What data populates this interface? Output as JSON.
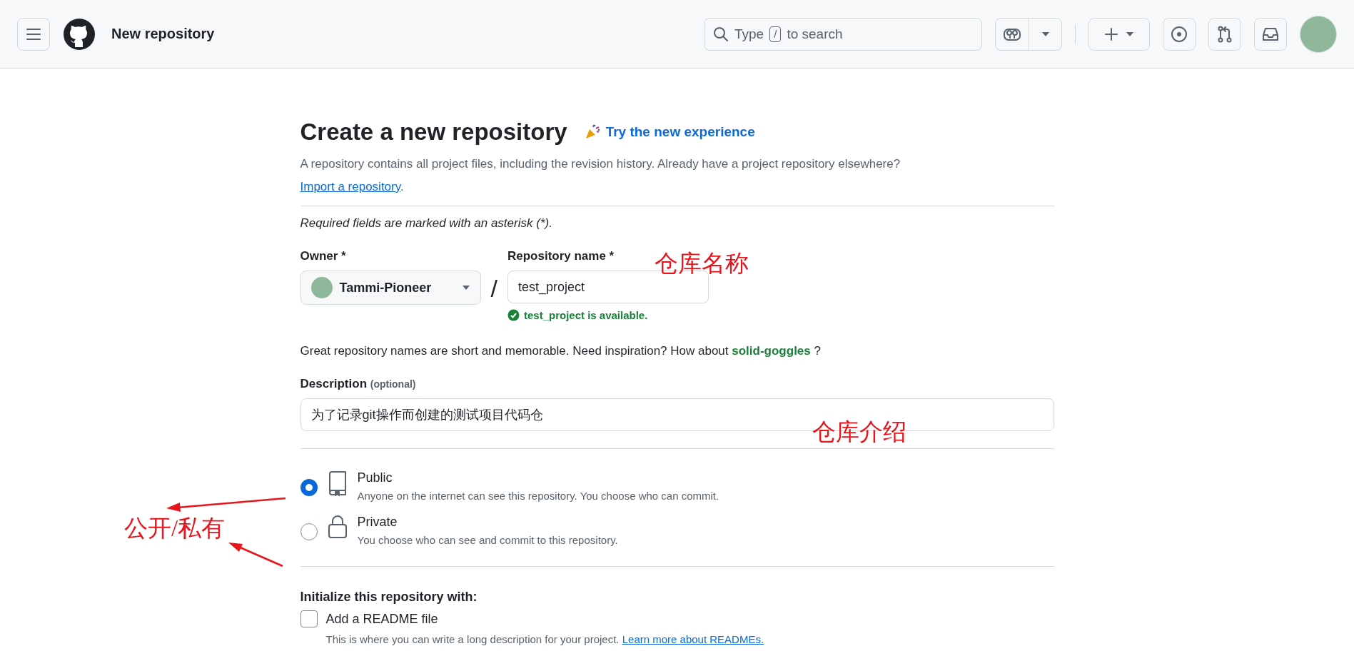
{
  "header": {
    "title": "New repository",
    "search": {
      "prefix": "Type",
      "shortcut": "/",
      "suffix": "to search"
    }
  },
  "form": {
    "title": "Create a new repository",
    "try_link": "Try the new experience",
    "intro": "A repository contains all project files, including the revision history. Already have a project repository elsewhere?",
    "import_link": "Import a repository",
    "intro_end": ".",
    "required_note": "Required fields are marked with an asterisk (*).",
    "owner": {
      "label": "Owner *",
      "value": "Tammi-Pioneer"
    },
    "separator": "/",
    "repo_name": {
      "label": "Repository name *",
      "value": "test_project",
      "status": "test_project is available."
    },
    "suggestion": {
      "text": "Great repository names are short and memorable. Need inspiration? How about",
      "name": "solid-goggles",
      "end": "?"
    },
    "description": {
      "label": "Description",
      "hint": "(optional)",
      "value": "为了记录git操作而创建的测试项目代码仓"
    },
    "visibility": [
      {
        "kind": "public",
        "label": "Public",
        "hint": "Anyone on the internet can see this repository. You choose who can commit.",
        "selected": true
      },
      {
        "kind": "private",
        "label": "Private",
        "hint": "You choose who can see and commit to this repository.",
        "selected": false
      }
    ],
    "initialize": {
      "heading": "Initialize this repository with:",
      "readme": {
        "label": "Add a README file",
        "checked": false,
        "hint": "This is where you can write a long description for your project.",
        "link": "Learn more about READMEs."
      }
    }
  },
  "annotations": [
    {
      "kind": "name",
      "text": "仓库名称"
    },
    {
      "kind": "description",
      "text": "仓库介绍"
    },
    {
      "kind": "visibility",
      "text": "公开/私有"
    }
  ]
}
